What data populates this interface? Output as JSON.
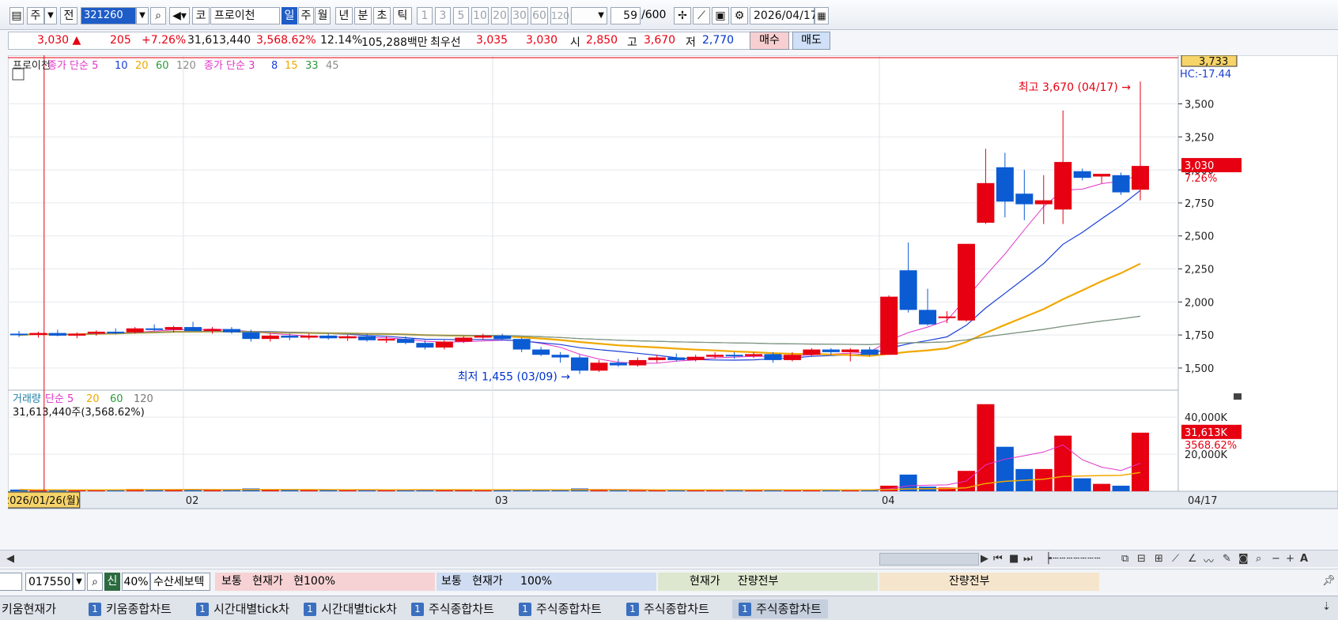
{
  "toolbar": {
    "market_tab": "주",
    "prev_label": "전",
    "code": "321260",
    "market_code": "코",
    "stock_name": "프로이천",
    "periods": [
      "일",
      "주",
      "월",
      "년",
      "분",
      "초",
      "틱"
    ],
    "active_period": "일",
    "intervals": [
      "1",
      "3",
      "5",
      "10",
      "20",
      "30",
      "60",
      "120"
    ],
    "count": "59",
    "count_total": "/600",
    "date": "2026/04/17"
  },
  "quote": {
    "price": "3,030 ▲",
    "change": "205",
    "change_pct": "+7.26%",
    "volume": "31,613,440",
    "volume_pct": "3,568.62%",
    "turnover": "12.14%",
    "amount": "105,288백만",
    "best_label": "최우선",
    "ask": "3,035",
    "bid": "3,030",
    "open_label": "시",
    "open": "2,850",
    "high_label": "고",
    "high": "3,670",
    "low_label": "저",
    "low": "2,770",
    "buy_label": "매수",
    "sell_label": "매도"
  },
  "chart_data": {
    "type": "candlestick",
    "legend_price": [
      "프로이천",
      "종가 단순 5",
      "10",
      "20",
      "60",
      "120",
      "종가 단순 3",
      "8",
      "15",
      "33",
      "45"
    ],
    "legend_volume": [
      "거래량",
      "단순 5",
      "20",
      "60",
      "120"
    ],
    "volume_readout": "31,613,440주(3,568.62%)",
    "price_axis_ticks": [
      "3,500",
      "3,250",
      "3,000",
      "2,750",
      "2,500",
      "2,250",
      "2,000",
      "1,750",
      "1,500"
    ],
    "price_axis_values": [
      3500,
      3250,
      3000,
      2750,
      2500,
      2250,
      2000,
      1750,
      1500
    ],
    "volume_axis_ticks": [
      "40,000K",
      "20,000K"
    ],
    "volume_axis_values": [
      40000,
      20000
    ],
    "price_ylim": [
      1380,
      3820
    ],
    "volume_ylim": [
      0,
      52000
    ],
    "top_readout": "3,733",
    "hc_readout": "HC:-17.44",
    "last_price_tag": "3,030",
    "last_pct_tag": "7.26%",
    "last_volume_tag": "31,613K",
    "last_volume_pct_tag": "3568.62%",
    "high_annotation": "최고 3,670 (04/17) →",
    "low_annotation": "최저 1,455 (03/09) →",
    "x_labels": [
      "2026/",
      "02",
      "03",
      "04",
      "04/17"
    ],
    "crosshair_date": "2026/01/26(월)",
    "colors": {
      "up": "#e60012",
      "down": "#0b5bd3",
      "ma5": "#e033c8",
      "ma10": "#1a3fd6",
      "ma20": "#f0a800",
      "ma60": "#2e9a3c",
      "ma120": "#8c8c8c"
    },
    "candles_early": [
      {
        "o": 1760,
        "h": 1780,
        "l": 1735,
        "c": 1750
      },
      {
        "o": 1750,
        "h": 1775,
        "l": 1730,
        "c": 1765
      },
      {
        "o": 1765,
        "h": 1790,
        "l": 1740,
        "c": 1745
      },
      {
        "o": 1745,
        "h": 1770,
        "l": 1725,
        "c": 1760
      },
      {
        "o": 1760,
        "h": 1785,
        "l": 1745,
        "c": 1775
      },
      {
        "o": 1775,
        "h": 1800,
        "l": 1755,
        "c": 1770
      },
      {
        "o": 1770,
        "h": 1810,
        "l": 1760,
        "c": 1800
      },
      {
        "o": 1800,
        "h": 1830,
        "l": 1780,
        "c": 1790
      },
      {
        "o": 1790,
        "h": 1820,
        "l": 1770,
        "c": 1810
      },
      {
        "o": 1810,
        "h": 1850,
        "l": 1790,
        "c": 1780
      },
      {
        "o": 1780,
        "h": 1810,
        "l": 1760,
        "c": 1795
      },
      {
        "o": 1795,
        "h": 1810,
        "l": 1760,
        "c": 1770
      },
      {
        "o": 1770,
        "h": 1790,
        "l": 1700,
        "c": 1720
      },
      {
        "o": 1720,
        "h": 1760,
        "l": 1700,
        "c": 1745
      },
      {
        "o": 1745,
        "h": 1760,
        "l": 1710,
        "c": 1730
      },
      {
        "o": 1730,
        "h": 1760,
        "l": 1715,
        "c": 1745
      },
      {
        "o": 1745,
        "h": 1760,
        "l": 1715,
        "c": 1725
      },
      {
        "o": 1725,
        "h": 1750,
        "l": 1705,
        "c": 1740
      },
      {
        "o": 1740,
        "h": 1760,
        "l": 1700,
        "c": 1710
      },
      {
        "o": 1710,
        "h": 1740,
        "l": 1690,
        "c": 1720
      },
      {
        "o": 1720,
        "h": 1740,
        "l": 1680,
        "c": 1690
      },
      {
        "o": 1690,
        "h": 1710,
        "l": 1640,
        "c": 1655
      },
      {
        "o": 1655,
        "h": 1710,
        "l": 1640,
        "c": 1700
      },
      {
        "o": 1700,
        "h": 1740,
        "l": 1690,
        "c": 1730
      },
      {
        "o": 1730,
        "h": 1760,
        "l": 1715,
        "c": 1745
      },
      {
        "o": 1745,
        "h": 1760,
        "l": 1710,
        "c": 1720
      },
      {
        "o": 1720,
        "h": 1730,
        "l": 1620,
        "c": 1640
      },
      {
        "o": 1640,
        "h": 1660,
        "l": 1590,
        "c": 1600
      },
      {
        "o": 1600,
        "h": 1620,
        "l": 1540,
        "c": 1580
      },
      {
        "o": 1580,
        "h": 1600,
        "l": 1455,
        "c": 1480
      },
      {
        "o": 1480,
        "h": 1560,
        "l": 1470,
        "c": 1540
      },
      {
        "o": 1540,
        "h": 1570,
        "l": 1510,
        "c": 1520
      },
      {
        "o": 1520,
        "h": 1580,
        "l": 1510,
        "c": 1560
      },
      {
        "o": 1560,
        "h": 1600,
        "l": 1540,
        "c": 1580
      },
      {
        "o": 1580,
        "h": 1610,
        "l": 1550,
        "c": 1560
      },
      {
        "o": 1560,
        "h": 1600,
        "l": 1550,
        "c": 1585
      },
      {
        "o": 1585,
        "h": 1620,
        "l": 1570,
        "c": 1600
      },
      {
        "o": 1600,
        "h": 1620,
        "l": 1570,
        "c": 1590
      },
      {
        "o": 1590,
        "h": 1620,
        "l": 1575,
        "c": 1605
      },
      {
        "o": 1605,
        "h": 1620,
        "l": 1540,
        "c": 1560
      },
      {
        "o": 1560,
        "h": 1620,
        "l": 1550,
        "c": 1600
      },
      {
        "o": 1600,
        "h": 1650,
        "l": 1590,
        "c": 1640
      },
      {
        "o": 1640,
        "h": 1650,
        "l": 1600,
        "c": 1620
      },
      {
        "o": 1620,
        "h": 1650,
        "l": 1550,
        "c": 1640
      },
      {
        "o": 1640,
        "h": 1660,
        "l": 1590,
        "c": 1600
      },
      {
        "o": 1600,
        "h": 2050,
        "l": 1600,
        "c": 2040
      },
      {
        "o": 2240,
        "h": 2450,
        "l": 1920,
        "c": 1940
      },
      {
        "o": 1940,
        "h": 2100,
        "l": 1820,
        "c": 1830
      },
      {
        "o": 1880,
        "h": 1930,
        "l": 1840,
        "c": 1890
      },
      {
        "o": 1860,
        "h": 2440,
        "l": 1850,
        "c": 2440
      },
      {
        "o": 2600,
        "h": 3160,
        "l": 2590,
        "c": 2900
      },
      {
        "o": 3020,
        "h": 3130,
        "l": 2640,
        "c": 2760
      },
      {
        "o": 2820,
        "h": 3000,
        "l": 2620,
        "c": 2740
      },
      {
        "o": 2740,
        "h": 2960,
        "l": 2590,
        "c": 2770
      },
      {
        "o": 2700,
        "h": 3450,
        "l": 2590,
        "c": 3060
      },
      {
        "o": 2990,
        "h": 3010,
        "l": 2920,
        "c": 2940
      },
      {
        "o": 2950,
        "h": 2970,
        "l": 2900,
        "c": 2970
      },
      {
        "o": 2960,
        "h": 2980,
        "l": 2810,
        "c": 2830
      },
      {
        "o": 2850,
        "h": 3670,
        "l": 2770,
        "c": 3030
      }
    ],
    "volumes_k": [
      900,
      600,
      800,
      700,
      700,
      900,
      1200,
      1000,
      900,
      1100,
      700,
      800,
      1500,
      900,
      700,
      600,
      700,
      600,
      700,
      500,
      800,
      900,
      800,
      700,
      600,
      700,
      900,
      800,
      900,
      1500,
      1000,
      700,
      600,
      500,
      700,
      600,
      500,
      600,
      700,
      600,
      500,
      800,
      900,
      1000,
      700,
      3000,
      9000,
      2500,
      2000,
      11000,
      47000,
      24000,
      12000,
      12000,
      30000,
      7000,
      4000,
      3000,
      31613
    ]
  },
  "order": {
    "code": "017550",
    "sin_label": "신",
    "pct": "40%",
    "stock": "수산세보텍",
    "block1_a": "보통",
    "block1_b": "현재가",
    "block1_c": "현100%",
    "block2_a": "보통",
    "block2_b": "현재가",
    "block2_c": "100%",
    "block3_a": "현재가",
    "block3_b": "잔량전부",
    "block4": "잔량전부"
  },
  "taskbar": [
    {
      "num": "",
      "label": "키움현재가"
    },
    {
      "num": "1",
      "label": "키움종합차트"
    },
    {
      "num": "1",
      "label": "시간대별tick차"
    },
    {
      "num": "1",
      "label": "시간대별tick차"
    },
    {
      "num": "1",
      "label": "주식종합차트"
    },
    {
      "num": "1",
      "label": "주식종합차트"
    },
    {
      "num": "1",
      "label": "주식종합차트"
    },
    {
      "num": "1",
      "label": "주식종합차트"
    }
  ]
}
